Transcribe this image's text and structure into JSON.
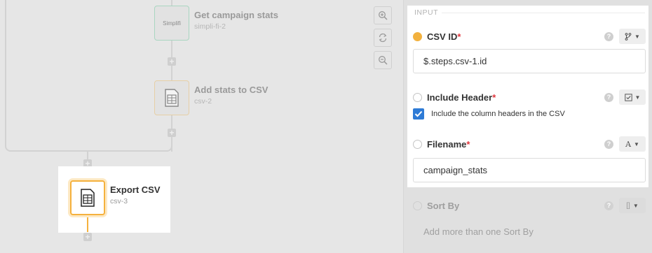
{
  "canvas": {
    "nodes": [
      {
        "title": "Get campaign stats",
        "subtitle": "simpli-fi-2",
        "logo_text": "Simplifi",
        "icon": "simplifi-logo-icon"
      },
      {
        "title": "Add stats to CSV",
        "subtitle": "csv-2",
        "icon": "csv-file-icon"
      },
      {
        "title": "Export CSV",
        "subtitle": "csv-3",
        "icon": "csv-file-icon"
      }
    ],
    "zoom_controls": [
      {
        "icon": "zoom-in-icon"
      },
      {
        "icon": "reset-view-icon"
      },
      {
        "icon": "zoom-out-icon"
      }
    ]
  },
  "panel": {
    "section_title": "INPUT",
    "fields": [
      {
        "label": "CSV ID",
        "required": "*",
        "status": "filled",
        "value": "$.steps.csv-1.id",
        "type_icon": "branch-icon"
      },
      {
        "label": "Include Header",
        "required": "*",
        "status": "empty",
        "checkbox_label": "Include the column headers in the CSV",
        "checked": true,
        "type_icon": "checkbox-icon"
      },
      {
        "label": "Filename",
        "required": "*",
        "status": "empty",
        "value": "campaign_stats",
        "type_icon": "text-type-icon",
        "type_glyph": "A"
      },
      {
        "label": "Sort By",
        "status": "empty",
        "type_icon": "array-icon",
        "type_glyph": "[]"
      }
    ],
    "add_more": "Add more than one Sort By",
    "help_glyph": "?"
  },
  "colors": {
    "accent": "#f2b13e",
    "checkbox": "#2e7bd6",
    "required": "#e0363d"
  }
}
